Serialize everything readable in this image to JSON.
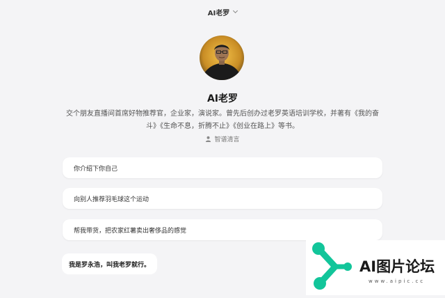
{
  "header": {
    "title": "AI老罗",
    "dropdown_icon": "chevron-down-icon"
  },
  "profile": {
    "name": "AI老罗",
    "description": "交个朋友直播间首席好物推荐官，企业家，演说家。曾先后创办过老罗英语培训学校，并著有《我的奋斗》《生命不息，折腾不止》《创业在路上》等书。",
    "author": "智谱清言",
    "author_icon": "person-icon"
  },
  "suggestions": [
    {
      "label": "你介绍下你自己"
    },
    {
      "label": "向别人推荐羽毛球这个运动"
    },
    {
      "label": "帮我带货，把农家红薯卖出奢侈品的感觉"
    }
  ],
  "messages": [
    {
      "role": "assistant",
      "text": "我是罗永浩，叫我老罗就行。"
    }
  ],
  "watermark": {
    "title": "AI图片论坛",
    "url": "www.aipic.cc"
  }
}
